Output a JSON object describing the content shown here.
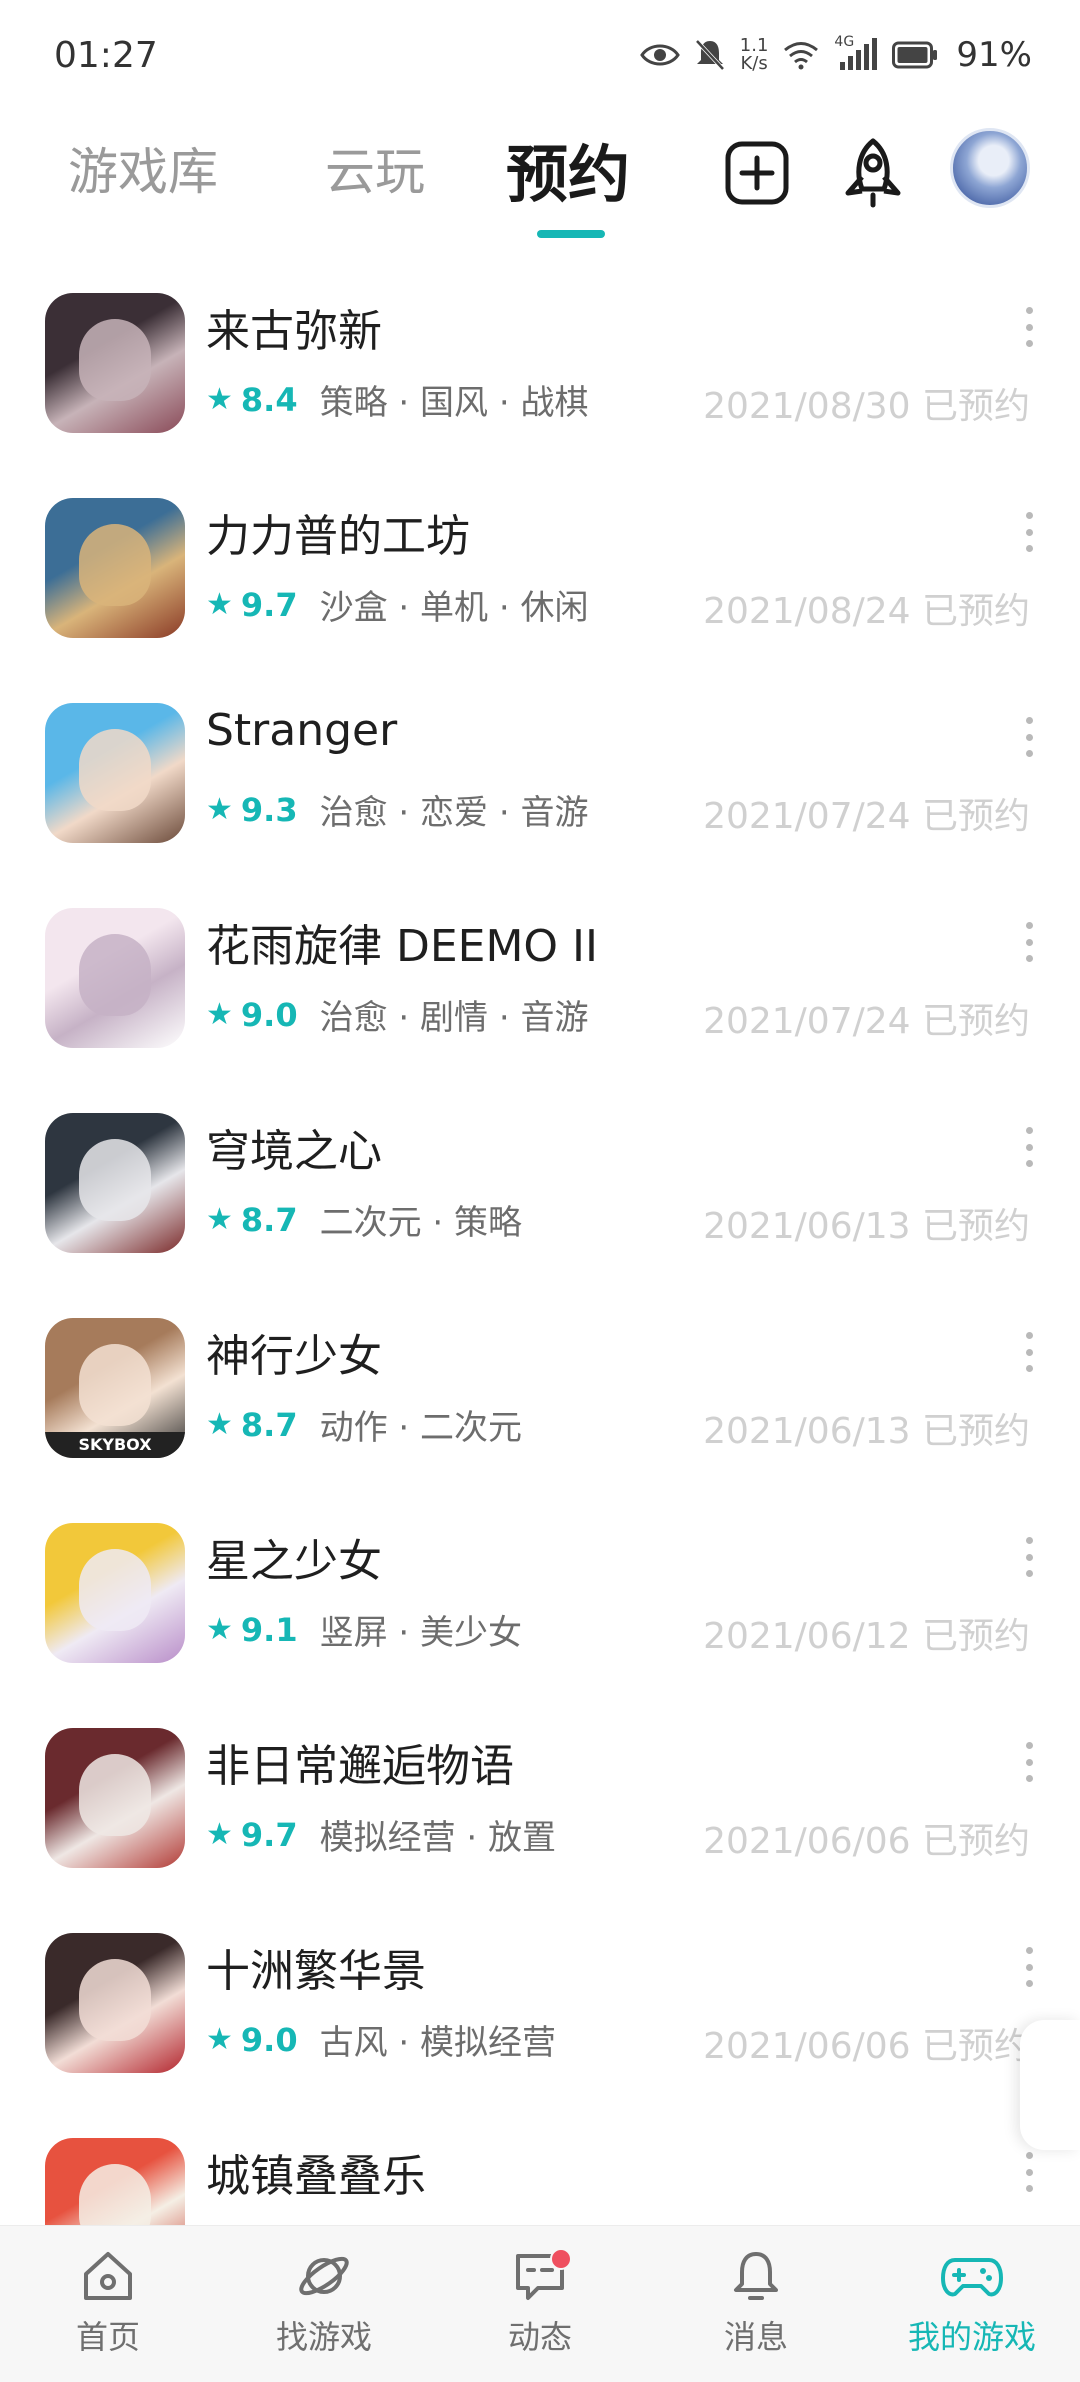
{
  "status_bar": {
    "time": "01:27",
    "net_speed_value": "1.1",
    "net_speed_unit": "K/s",
    "network_type": "4G",
    "battery": "91%"
  },
  "top_tabs": {
    "library": "游戏库",
    "cloud": "云玩",
    "reserve": "预约",
    "active": "reserve"
  },
  "games": [
    {
      "title": "来古弥新",
      "score": "8.4",
      "tags": "策略 · 国风 · 战棋",
      "date": "2021/08/30 已预约",
      "icon_colors": [
        "#3b2f36",
        "#c7b3b8",
        "#8a4a58"
      ]
    },
    {
      "title": "力力普的工坊",
      "score": "9.7",
      "tags": "沙盒 · 单机 · 休闲",
      "date": "2021/08/24 已预约",
      "icon_colors": [
        "#3c6e96",
        "#d9b47a",
        "#8a3a26"
      ]
    },
    {
      "title": "Stranger",
      "score": "9.3",
      "tags": "治愈 · 恋爱 · 音游",
      "date": "2021/07/24 已预约",
      "icon_colors": [
        "#5ab7e8",
        "#f1d9c8",
        "#6b4a3a"
      ]
    },
    {
      "title": "花雨旋律 DEEMO II",
      "score": "9.0",
      "tags": "治愈 · 剧情 · 音游",
      "date": "2021/07/24 已预约",
      "icon_colors": [
        "#f3e6ee",
        "#c6b2c6",
        "#ffffff"
      ]
    },
    {
      "title": "穹境之心",
      "score": "8.7",
      "tags": "二次元 · 策略",
      "date": "2021/06/13 已预约",
      "icon_colors": [
        "#2e3640",
        "#e6e6ea",
        "#7b2a2a"
      ]
    },
    {
      "title": "神行少女",
      "score": "8.7",
      "tags": "动作 · 二次元",
      "date": "2021/06/13 已预约",
      "icon_colors": [
        "#a67b5b",
        "#f3e1d2",
        "#2b2b2b"
      ],
      "icon_caption": "SKYBOX"
    },
    {
      "title": "星之少女",
      "score": "9.1",
      "tags": "竖屏 · 美少女",
      "date": "2021/06/12 已预约",
      "icon_colors": [
        "#f2c83a",
        "#efeaf4",
        "#b98ec9"
      ]
    },
    {
      "title": "非日常邂逅物语",
      "score": "9.7",
      "tags": "模拟经营 · 放置",
      "date": "2021/06/06 已预约",
      "icon_colors": [
        "#6a2a2e",
        "#efe7e4",
        "#b23b36"
      ]
    },
    {
      "title": "十洲繁华景",
      "score": "9.0",
      "tags": "古风 · 模拟经营",
      "date": "2021/06/06 已预约",
      "icon_colors": [
        "#3a2a2a",
        "#f2ddd6",
        "#b3262e"
      ]
    },
    {
      "title": "城镇叠叠乐",
      "score": "",
      "tags": "",
      "date": "",
      "icon_colors": [
        "#e7523f",
        "#f5efe5",
        "#c43728"
      ]
    }
  ],
  "bottom_nav": [
    {
      "label": "首页",
      "icon": "home-icon"
    },
    {
      "label": "找游戏",
      "icon": "planet-icon"
    },
    {
      "label": "动态",
      "icon": "chat-icon",
      "badge": true
    },
    {
      "label": "消息",
      "icon": "bell-icon"
    },
    {
      "label": "我的游戏",
      "icon": "gamepad-icon",
      "active": true
    }
  ],
  "colors": {
    "accent": "#16b7b5",
    "badge": "#ef4f5f",
    "muted_date": "#d0d0d0"
  }
}
